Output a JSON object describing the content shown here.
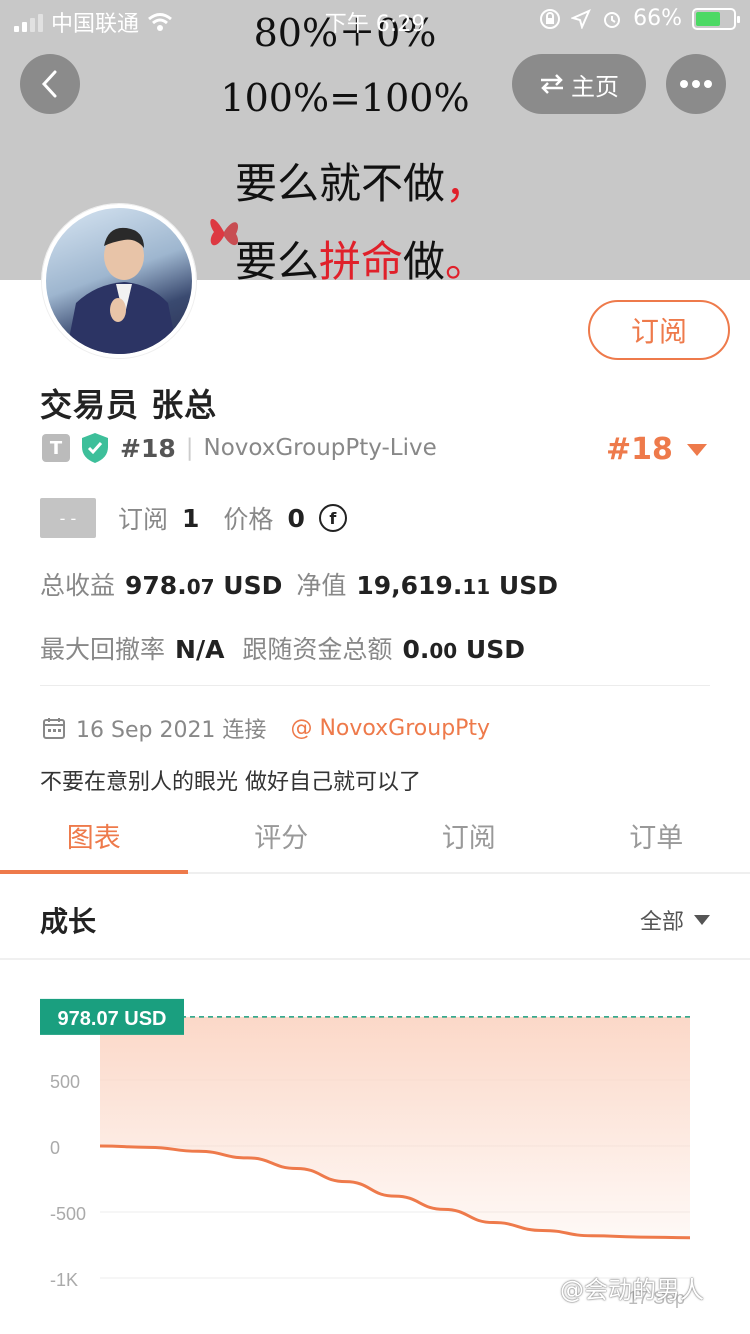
{
  "statusbar": {
    "carrier": "中国联通",
    "time": "下午 6:29",
    "battery": "66%",
    "battery_level": 0.66
  },
  "cover": {
    "line1": "80%＋0%",
    "line2": "100%=100%",
    "line3_text": "要么就不做",
    "line3_punct": "，",
    "line4_pre": "要么",
    "line4_red": "拼命",
    "line4_post": "做",
    "line4_punct": "。"
  },
  "header": {
    "home_label": "主页"
  },
  "profile": {
    "subscribe_label": "订阅",
    "name": "交易员  张总",
    "type_badge": "T",
    "rank": "#18",
    "account": "NovoxGroupPty-Live",
    "rank_big": "#18",
    "placeholder": "- -",
    "subs_label": "订阅",
    "subs_value": "1",
    "price_label": "价格",
    "price_value": "0",
    "coin_symbol": "f",
    "profit_label": "总收益",
    "profit_int": "978.",
    "profit_dec": "07",
    "profit_unit": "USD",
    "equity_label": "净值",
    "equity_int": "19,619.",
    "equity_dec": "11",
    "equity_unit": "USD",
    "drawdown_label": "最大回撤率",
    "drawdown_value": "N/A",
    "follow_label": "跟随资金总额",
    "follow_int": "0.",
    "follow_dec": "00",
    "follow_unit": "USD",
    "date": "16 Sep 2021 连接",
    "broker": "NovoxGroupPty",
    "bio": "不要在意别人的眼光 做好自己就可以了"
  },
  "tabs": [
    "图表",
    "评分",
    "订阅",
    "订单"
  ],
  "growth": {
    "title": "成长",
    "filter": "全部"
  },
  "chart_data": {
    "type": "area",
    "value_label": "978.07 USD",
    "highlight_value": 978.07,
    "ylim": [
      -1000,
      1000
    ],
    "yticks": [
      500,
      0,
      -500,
      -1000
    ],
    "ytick_labels": [
      "500",
      "0",
      "-500",
      "-1K"
    ],
    "x_tick_label": "17 Sep",
    "series": [
      {
        "values": [
          0,
          -10,
          -40,
          -90,
          -170,
          -270,
          -380,
          -480,
          -580,
          -640,
          -680,
          -690,
          -695
        ]
      }
    ],
    "colors": {
      "line": "#ee7a4b",
      "fill": "#fbd6c5",
      "label_bg": "#1a9f7f"
    }
  },
  "watermark": "@会动的男人"
}
